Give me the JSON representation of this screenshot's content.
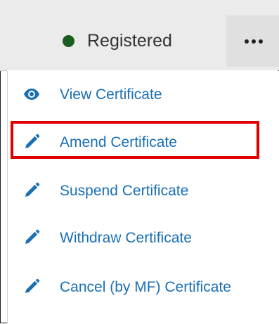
{
  "status": {
    "label": "Registered",
    "dot_color": "#1b5e20",
    "more_button": "more-horizontal-icon"
  },
  "menu": {
    "items": [
      {
        "label": "View Certificate",
        "icon": "eye-icon"
      },
      {
        "label": "Amend Certificate",
        "icon": "pencil-icon",
        "highlighted": true
      },
      {
        "label": "Suspend Certificate",
        "icon": "pencil-icon"
      },
      {
        "label": "Withdraw Certificate",
        "icon": "pencil-icon"
      },
      {
        "label": "Cancel (by MF) Certificate",
        "icon": "pencil-icon"
      }
    ],
    "link_color": "#1a6fb5",
    "highlight_color": "#e00000"
  }
}
